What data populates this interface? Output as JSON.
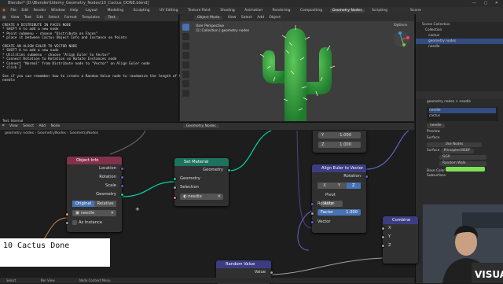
{
  "window": {
    "title": "Blender* [D:\\Blender\\Udemy_Geometry_Nodes\\10_Cactus_DONE.blend]",
    "controls": "— ▢ ✕"
  },
  "menubar": {
    "menus": [
      "File",
      "Edit",
      "Render",
      "Window",
      "Help"
    ],
    "workspaces": [
      "Layout",
      "Modeling",
      "Sculpting",
      "UV Editing",
      "Texture Paint",
      "Shading",
      "Animation",
      "Rendering",
      "Compositing",
      "Geometry Nodes",
      "Scripting"
    ],
    "active_workspace": "Geometry Nodes",
    "scene": "Scene"
  },
  "text_editor": {
    "menus": [
      "View",
      "Text",
      "Edit",
      "Select",
      "Format",
      "Templates"
    ],
    "file_name": "Text",
    "lines": [
      "CREATE A DISTRIBUTE IN FACES NODE",
      "* SHIFT A to add a new node",
      "* Point submenu - choose \"Distribute on Faces\"",
      "* place it between Cactus Object Info and Instance on Points",
      "",
      "CREATE AN ALIGN EULER TO VECTOR NODE",
      "* SHIFT A to add a new node",
      "* Utilities submenu - choose \"Align Euler to Vector\"",
      "* Connect Rotation to Rotation on Rotate Instances node",
      "* Connect \"Normal\" from Distribute node to \"Vector\" on Align Euler node",
      "* click Z",
      "",
      "See if you can remember how to create a Random Value node to randomize the length of the",
      "needle"
    ]
  },
  "viewport": {
    "menus": [
      "Object Mode",
      "View",
      "Select",
      "Add",
      "Object"
    ],
    "options_label": "Options",
    "info_line1": "User Perspective",
    "info_line2": "(1) Collection | geometry nodes"
  },
  "outliner": {
    "items": [
      {
        "label": "Scene Collection",
        "selected": false
      },
      {
        "label": "Collection",
        "selected": false
      },
      {
        "label": "cactus",
        "selected": false
      },
      {
        "label": "geometry nodes",
        "selected": true
      },
      {
        "label": "needle",
        "selected": false
      }
    ]
  },
  "properties": {
    "breadcrumb_obj": "geometry nodes",
    "breadcrumb_mat": "needle",
    "material_slots": [
      "needle",
      "cactus"
    ],
    "material_name": "needle",
    "preview_label": "Preview",
    "surface_label": "Surface",
    "use_nodes": "Use Nodes",
    "surface_label2": "Surface",
    "surface_value": "Principled BSDF",
    "ggx": "GGX",
    "random_walk": "Random Walk",
    "base_color_label": "Base Color",
    "subsurface_label": "Subsurface",
    "base_color": "#7fe05a"
  },
  "node_editor": {
    "header_menus": [
      "View",
      "Select",
      "Add",
      "Node"
    ],
    "editor_type": "Geometry Nodes",
    "breadcrumb": [
      "geometry nodes",
      "GeometryNodes",
      "GeometryNodes"
    ],
    "text_tab_label": "Text: Internal"
  },
  "nodes": {
    "object_info": {
      "title": "Object Info",
      "outputs": [
        "Location",
        "Rotation",
        "Scale",
        "Geometry"
      ],
      "mode_original": "Original",
      "mode_relative": "Relative",
      "object": "needle",
      "as_instance": "As Instance"
    },
    "set_material": {
      "title": "Set Material",
      "output": "Geometry",
      "inputs": [
        "Geometry",
        "Selection"
      ],
      "material": "needle"
    },
    "align_euler": {
      "title": "Align Euler to Vector",
      "output": "Rotation",
      "axes": [
        "X",
        "Y",
        "Z"
      ],
      "active_axis": "Z",
      "pivot_label": "Pivot",
      "pivot_value": "Auto",
      "rotation_label": "Rotation",
      "factor_label": "Factor",
      "factor_value": "1.000",
      "vector_label": "Vector"
    },
    "vector_fields": {
      "y_label": "Y",
      "y_value": "1.000",
      "z_label": "Z",
      "z_value": "1.000"
    },
    "combine": {
      "title": "Combine",
      "inputs": [
        "X",
        "Y",
        "Z"
      ]
    },
    "random_value": {
      "title": "Random Value",
      "output": "Value"
    }
  },
  "caption": "10 Cactus Done",
  "statusbar": {
    "items": [
      "Select",
      "Pan View",
      "Node Context Menu"
    ]
  },
  "colors": {
    "accent": "#4772b3",
    "geometry_socket": "#00d6a3",
    "vector_socket": "#6363c7",
    "cactus_green": "#3aa23a"
  }
}
